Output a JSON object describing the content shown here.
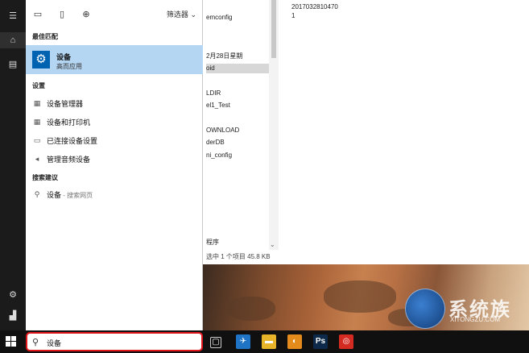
{
  "explorer": {
    "files": [
      "emconfig",
      "2月28日星期",
      "oid",
      "LDIR",
      "el1_Test",
      "OWNLOAD",
      "derDB",
      "ni_config",
      "程序"
    ],
    "selected_index": 2,
    "details": [
      "2017032810470",
      "1"
    ],
    "status": "选中 1 个项目  45.8 KB"
  },
  "rail": {
    "icons": [
      "hamburger-icon",
      "home-icon",
      "document-icon",
      "settings-icon",
      "user-icon"
    ]
  },
  "panel": {
    "header_icons": [
      "apps-icon",
      "document-icon",
      "web-icon"
    ],
    "filter_label": "筛选器",
    "best_match_heading": "最佳匹配",
    "best_match": {
      "title": "设备",
      "subtitle": "高而应用"
    },
    "settings_heading": "设置",
    "settings_items": [
      {
        "label": "设备管理器",
        "icon": "device-manager-icon"
      },
      {
        "label": "设备和打印机",
        "icon": "printer-icon"
      },
      {
        "label": "已连接设备设置",
        "icon": "connected-devices-icon"
      },
      {
        "label": "管理音频设备",
        "icon": "speaker-icon"
      }
    ],
    "suggestions_heading": "搜索建议",
    "suggestion": {
      "label": "设备",
      "sub": " - 搜索网页"
    }
  },
  "taskbar": {
    "search_value": "设备",
    "apps": [
      {
        "name": "task-view-icon",
        "glyph": "▢",
        "color": "#101010"
      },
      {
        "name": "feather-app-icon",
        "glyph": "✈",
        "color": "#1f74c6"
      },
      {
        "name": "file-explorer-icon",
        "glyph": "▬",
        "color": "#e8b42a"
      },
      {
        "name": "browser-icon",
        "glyph": "◐",
        "color": "#e48b1c"
      },
      {
        "name": "photoshop-icon",
        "glyph": "Ps",
        "color": "#0d2a4a"
      },
      {
        "name": "netease-music-icon",
        "glyph": "◎",
        "color": "#d32a22"
      }
    ]
  },
  "watermark": {
    "text": "系统族",
    "sub": "XITONGZU.COM"
  },
  "colors": {
    "accent": "#0063b1",
    "highlight": "#b5d6f2",
    "search_border": "#e0161c"
  }
}
